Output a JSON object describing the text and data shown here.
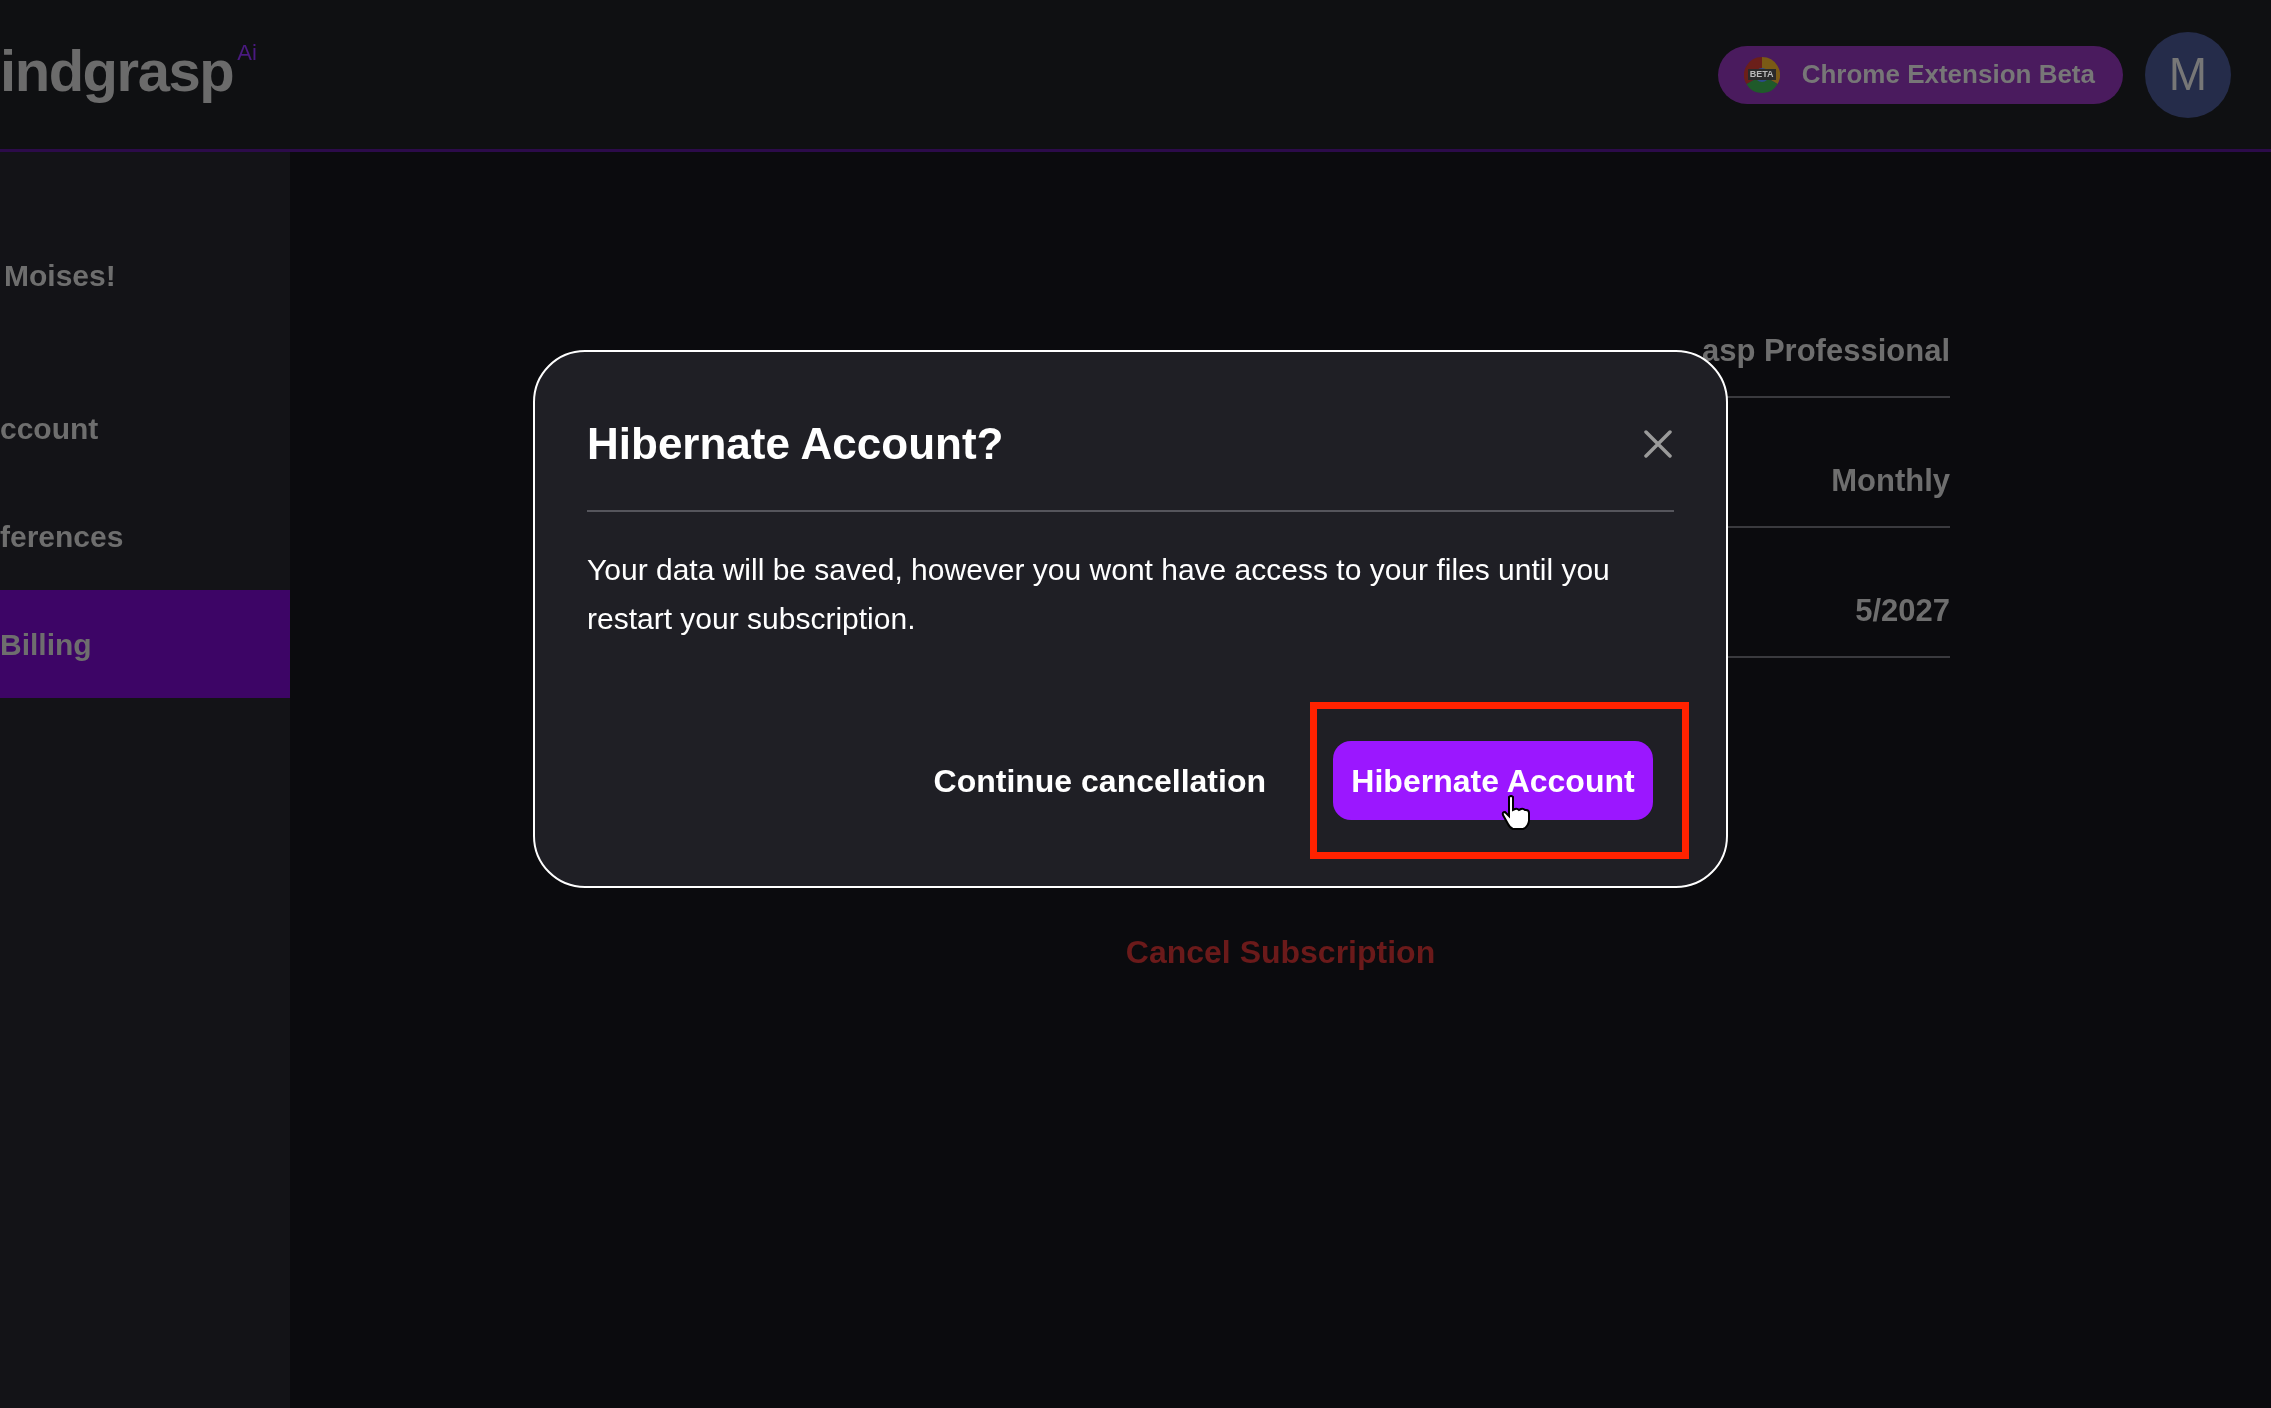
{
  "header": {
    "logo": "indgrasp",
    "logo_badge": "Ai",
    "extension_button": {
      "icon_label": "BETA",
      "label": "Chrome Extension Beta"
    },
    "avatar": "M"
  },
  "sidebar": {
    "greeting": "Moises!",
    "items": [
      {
        "label": "ccount",
        "selected": false
      },
      {
        "label": "ferences",
        "selected": false
      },
      {
        "label": "Billing",
        "selected": true
      }
    ]
  },
  "details": [
    {
      "value": "asp Professional"
    },
    {
      "value": "Monthly"
    },
    {
      "value": "5/2027"
    }
  ],
  "cancel_link": "Cancel Subscription",
  "dialog": {
    "title": "Hibernate Account?",
    "message": "Your data will be saved, however you wont have access to your files until you restart your subscription.",
    "secondary_button": "Continue cancellation",
    "primary_button": "Hibernate Account",
    "highlighted": true
  }
}
